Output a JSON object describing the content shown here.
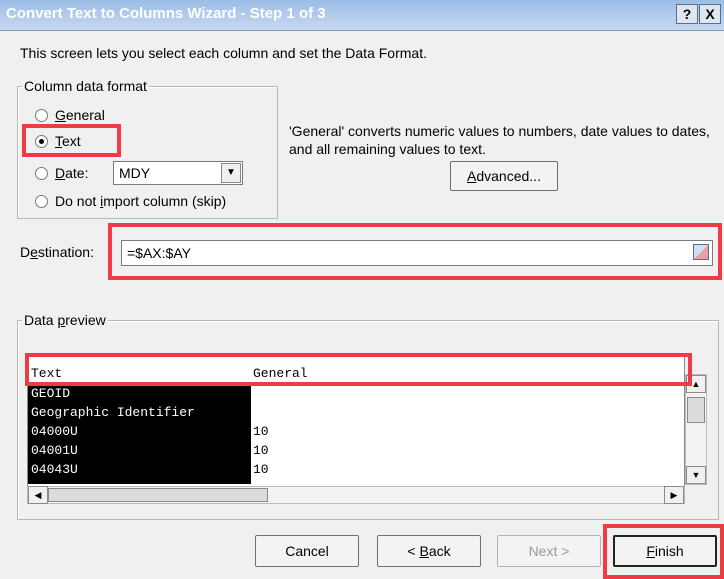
{
  "window": {
    "title": "Convert Text to Columns Wizard - Step 1 of 3",
    "help_label": "?",
    "close_label": "X"
  },
  "intro_text": "This screen lets you select each column and set the Data Format.",
  "column_format": {
    "legend": "Column data format",
    "options": {
      "general": {
        "pre": "",
        "key": "G",
        "post": "eneral",
        "selected": false
      },
      "text": {
        "pre": "",
        "key": "T",
        "post": "ext",
        "selected": true
      },
      "date": {
        "pre": "",
        "key": "D",
        "post": "ate:",
        "selected": false
      },
      "skip": {
        "pre": "Do not ",
        "key": "i",
        "post": "mport column (skip)",
        "selected": false
      }
    },
    "date_format_value": "MDY"
  },
  "description": "'General' converts numeric values to numbers, date values to dates, and all remaining values to text.",
  "advanced_button": {
    "key": "A",
    "rest": "dvanced..."
  },
  "destination": {
    "label_pre": "D",
    "label_key": "e",
    "label_post": "stination:",
    "value": "=$AX:$AY"
  },
  "preview": {
    "legend_pre": "Data ",
    "legend_key": "p",
    "legend_post": "review",
    "headers": [
      "Text",
      "General"
    ],
    "rows": [
      [
        "GEOID",
        ""
      ],
      [
        "Geographic Identifier",
        ""
      ],
      [
        "04000U",
        "10"
      ],
      [
        "04001U",
        "10"
      ],
      [
        "04043U",
        "10"
      ]
    ]
  },
  "buttons": {
    "cancel": {
      "pre": "Cancel",
      "key": "",
      "post": ""
    },
    "back": {
      "pre": "< ",
      "key": "B",
      "post": "ack"
    },
    "next": {
      "pre": "Next >",
      "key": "",
      "post": ""
    },
    "finish": {
      "pre": "",
      "key": "F",
      "post": "inish"
    }
  },
  "highlight_color": "#ee3b46"
}
